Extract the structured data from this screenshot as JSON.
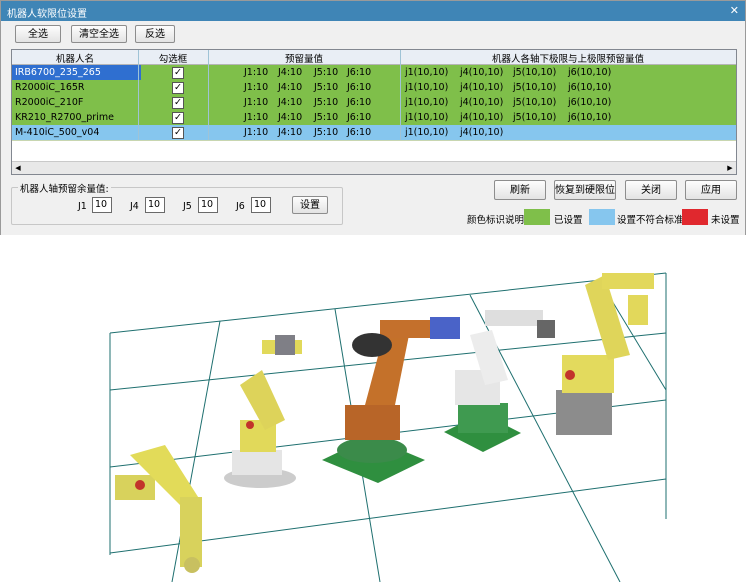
{
  "window": {
    "title": "机器人软限位设置",
    "close_label": "✕"
  },
  "toolbar": {
    "select_all": "全选",
    "clear_all": "清空全选",
    "invert": "反选"
  },
  "table": {
    "headers": {
      "name": "机器人名",
      "check": "勾选框",
      "margin": "预留量值",
      "limits": "机器人各轴下极限与上极限预留量值"
    },
    "rows": [
      {
        "name": "IRB6700_235_265",
        "checked": "✓",
        "j1": "J1:10",
        "j4": "J4:10",
        "j5": "J5:10",
        "j6": "J6:10",
        "l1": "j1(10,10)",
        "l4": "j4(10,10)",
        "l5": "j5(10,10)",
        "l6": "j6(10,10)"
      },
      {
        "name": "R2000iC_165R",
        "checked": "✓",
        "j1": "J1:10",
        "j4": "J4:10",
        "j5": "J5:10",
        "j6": "J6:10",
        "l1": "j1(10,10)",
        "l4": "j4(10,10)",
        "l5": "j5(10,10)",
        "l6": "j6(10,10)"
      },
      {
        "name": "R2000iC_210F",
        "checked": "✓",
        "j1": "J1:10",
        "j4": "J4:10",
        "j5": "J5:10",
        "j6": "J6:10",
        "l1": "j1(10,10)",
        "l4": "j4(10,10)",
        "l5": "j5(10,10)",
        "l6": "j6(10,10)"
      },
      {
        "name": "KR210_R2700_prime",
        "checked": "✓",
        "j1": "J1:10",
        "j4": "J4:10",
        "j5": "J5:10",
        "j6": "J6:10",
        "l1": "j1(10,10)",
        "l4": "j4(10,10)",
        "l5": "j5(10,10)",
        "l6": "j6(10,10)"
      },
      {
        "name": "M-410iC_500_v04",
        "checked": "✓",
        "j1": "J1:10",
        "j4": "J4:10",
        "j5": "J5:10",
        "j6": "J6:10",
        "l1": "j1(10,10)",
        "l4": "j4(10,10)",
        "l5": "",
        "l6": ""
      }
    ]
  },
  "actions": {
    "refresh": "刷新",
    "restore": "恢复到硬限位",
    "close": "关闭",
    "apply": "应用"
  },
  "margin_group": {
    "label": "机器人轴预留余量值:",
    "j1_label": "J1",
    "j1_value": "10",
    "j4_label": "J4",
    "j4_value": "10",
    "j5_label": "J5",
    "j5_value": "10",
    "j6_label": "J6",
    "j6_value": "10",
    "set_button": "设置"
  },
  "legend": {
    "title": "颜色标识说明:",
    "items": [
      {
        "label": "已设置",
        "color": "#7fbf4a"
      },
      {
        "label": "设置不符合标准",
        "color": "#86c6ee"
      },
      {
        "label": "未设置",
        "color": "#e0282e"
      }
    ]
  }
}
